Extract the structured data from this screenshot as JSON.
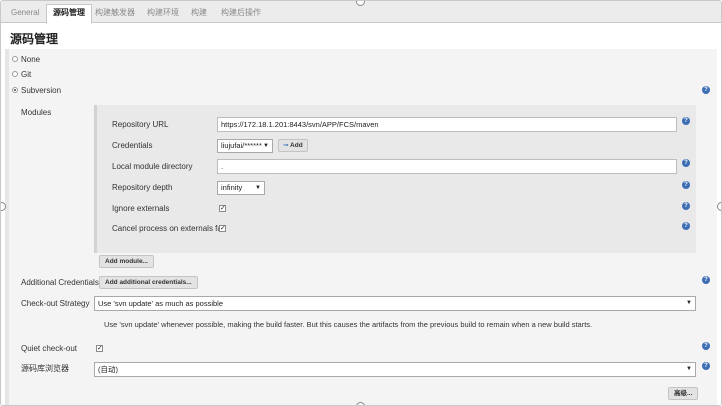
{
  "tabs": [
    "General",
    "源码管理",
    "构建触发器",
    "构建环境",
    "构建",
    "构建后操作"
  ],
  "section_title": "源码管理",
  "scm_options": {
    "none": "None",
    "git": "Git",
    "subversion": "Subversion",
    "selected": "Subversion"
  },
  "modules": {
    "label": "Modules",
    "repository_url_label": "Repository URL",
    "repository_url": "https://172.18.1.201:8443/svn/APP/FCS/maven",
    "credentials_label": "Credentials",
    "credentials_value": "liujufai/******",
    "add_label": "Add",
    "local_dir_label": "Local module directory",
    "local_dir_value": ".",
    "depth_label": "Repository depth",
    "depth_value": "infinity",
    "ignore_externals_label": "Ignore externals",
    "ignore_externals_checked": true,
    "cancel_process_label": "Cancel process on externals fail",
    "cancel_process_checked": true,
    "add_module_label": "Add module..."
  },
  "additional_credentials": {
    "label": "Additional Credentials",
    "button_label": "Add additional credentials..."
  },
  "checkout_strategy": {
    "label": "Check-out Strategy",
    "value": "Use 'svn update' as much as possible",
    "description": "Use 'svn update' whenever possible, making the build faster. But this causes the artifacts from the previous build to remain when a new build starts."
  },
  "quiet_checkout": {
    "label": "Quiet check-out",
    "checked": true
  },
  "repo_browser": {
    "label": "源码库浏览器",
    "value": "(自动)"
  },
  "advanced_label": "高级...",
  "help_glyph": "?"
}
